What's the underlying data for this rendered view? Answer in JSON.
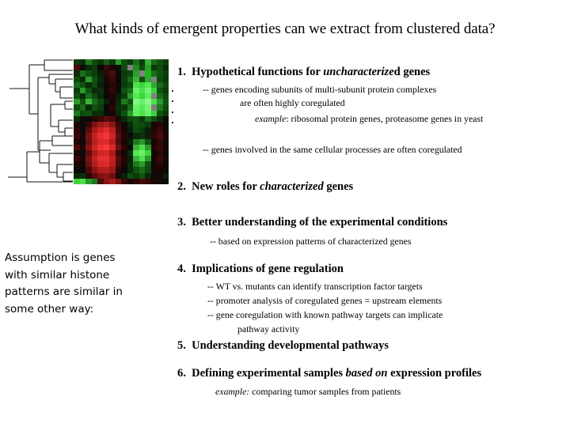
{
  "slide": {
    "title": "What kinds of emergent properties can we extract from clustered data?",
    "background_color": "#ffffff",
    "text_color": "#000000"
  },
  "figure": {
    "name": "hierarchical-clustering-heatmap",
    "colors": {
      "high_expression": "#00ff00",
      "low_expression": "#ff0000",
      "no_change": "#000000",
      "missing_data": "#808080",
      "dendrogram_line": "#000000"
    },
    "rows": 22,
    "columns": 16,
    "row_ellipsis_dots": 4,
    "heatmap_cells": [
      [
        "#0b3d0b",
        "#0a2f0a",
        "#1f7a1f",
        "#0d4a0d",
        "#083708",
        "#156015",
        "#0a3a0a",
        "#2a9a2a",
        "#0e4f0e",
        "#0a3a0a",
        "#1c6f1c",
        "#0a3a0a",
        "#37b337",
        "#1a6b1a",
        "#0f520f",
        "#0a3a0a"
      ],
      [
        "#4a0808",
        "#120c08",
        "#0a2a0a",
        "#0d3a0d",
        "#080808",
        "#3c0606",
        "#1a0505",
        "#0a0a0a",
        "#0f4a0f",
        "#808080",
        "#22881f",
        "#0d4a0d",
        "#2e9e2e",
        "#0a3a0a",
        "#0d4a0d",
        "#0a2a0a"
      ],
      [
        "#0a2a0a",
        "#1a6b1a",
        "#0f520f",
        "#0b3d0b",
        "#081f08",
        "#2a0808",
        "#4a0a0a",
        "#0a0a0a",
        "#0a3a0a",
        "#0d4a0d",
        "#2e9e2e",
        "#808080",
        "#15bd15",
        "#1a6b1a",
        "#0f520f",
        "#0b3d0b"
      ],
      [
        "#0d4a0d",
        "#0a2a0a",
        "#2a9a2a",
        "#0f520f",
        "#0a2a0a",
        "#180505",
        "#3a0707",
        "#080808",
        "#0b3d0b",
        "#1a6b1a",
        "#3cb33c",
        "#0f520f",
        "#2fa82f",
        "#808080",
        "#0d4a0d",
        "#0a3a0a"
      ],
      [
        "#1a6b1a",
        "#0f520f",
        "#0a2a0a",
        "#0d4a0d",
        "#081f08",
        "#0a0a0a",
        "#2a0606",
        "#120808",
        "#0a3a0a",
        "#0d4a0d",
        "#4ede4e",
        "#3cd43c",
        "#55ea55",
        "#2fa82f",
        "#1a6b1a",
        "#0d4a0d"
      ],
      [
        "#0b3d0b",
        "#2a9a2a",
        "#0f520f",
        "#0a2a0a",
        "#0d2f0d",
        "#180505",
        "#350606",
        "#0a0a0a",
        "#0f520f",
        "#1a6b1a",
        "#6bf06b",
        "#4ede4e",
        "#72f572",
        "#3cd43c",
        "#0f520f",
        "#0a3a0a"
      ],
      [
        "#0f520f",
        "#0a2a0a",
        "#1a6b1a",
        "#0d4a0d",
        "#0a2a0a",
        "#0a0a0a",
        "#220505",
        "#081f08",
        "#0b3d0b",
        "#2a9a2a",
        "#55ea55",
        "#3cd43c",
        "#5fee5f",
        "#808080",
        "#1a6b1a",
        "#0d4a0d"
      ],
      [
        "#2a9a2a",
        "#0f520f",
        "#3cb33c",
        "#1a6b1a",
        "#0d4a0d",
        "#0a1f0a",
        "#1a0505",
        "#0a2a0a",
        "#1f7a1f",
        "#0f520f",
        "#7ff87f",
        "#6bf06b",
        "#8afa8a",
        "#4ede4e",
        "#2a9a2a",
        "#0f520f"
      ],
      [
        "#0d4a0d",
        "#1a6b1a",
        "#0a2a0a",
        "#0f520f",
        "#0b3d0b",
        "#080808",
        "#2a0606",
        "#0d2f0d",
        "#0a3a0a",
        "#1a6b1a",
        "#6bf06b",
        "#55ea55",
        "#72f572",
        "#808080",
        "#1f7a1f",
        "#0d4a0d"
      ],
      [
        "#1f7a1f",
        "#0d4a0d",
        "#0f520f",
        "#0a2a0a",
        "#0a2a0a",
        "#0d0a0a",
        "#1a0505",
        "#0a2a0a",
        "#0f520f",
        "#2a9a2a",
        "#5fee5f",
        "#4ede4e",
        "#66ef66",
        "#3cd43c",
        "#0f520f",
        "#0a3a0a"
      ],
      [
        "#0a2a0a",
        "#120808",
        "#0a0a0a",
        "#2a0606",
        "#3a0707",
        "#5a0c0c",
        "#4a0a0a",
        "#1a0505",
        "#0a2a0a",
        "#0d4a0d",
        "#0f520f",
        "#0a3a0a",
        "#1a6b1a",
        "#0d4a0d",
        "#0a2a0a",
        "#120808"
      ],
      [
        "#1a0505",
        "#0a0a0a",
        "#350606",
        "#7a1212",
        "#9a1a1a",
        "#b01f1f",
        "#8a1515",
        "#3a0707",
        "#0d0a0a",
        "#0a2a0a",
        "#0f520f",
        "#0d4a0d",
        "#0a3a0a",
        "#180505",
        "#2a0606",
        "#0a0a0a"
      ],
      [
        "#2a0606",
        "#0d0a0a",
        "#5a0c0c",
        "#a81c1c",
        "#cf2424",
        "#e02b2b",
        "#b82020",
        "#4a0a0a",
        "#180505",
        "#0a1f0a",
        "#0d4a0d",
        "#0a3a0a",
        "#081f08",
        "#220505",
        "#3a0707",
        "#120808"
      ],
      [
        "#3a0707",
        "#180505",
        "#7a1212",
        "#c02222",
        "#e83030",
        "#f23636",
        "#cf2424",
        "#5a0c0c",
        "#220505",
        "#0a0a0a",
        "#0a2a0a",
        "#0d2f0d",
        "#0a1f0a",
        "#2a0606",
        "#4a0a0a",
        "#1a0505"
      ],
      [
        "#220505",
        "#0d0a0a",
        "#6a1010",
        "#b82020",
        "#d82828",
        "#e02b2b",
        "#b01f1f",
        "#4a0a0a",
        "#1a0505",
        "#0a1f0a",
        "#1f7a1f",
        "#2a9a2a",
        "#0f520f",
        "#180505",
        "#350606",
        "#0a0a0a"
      ],
      [
        "#4a0a0a",
        "#220505",
        "#8a1515",
        "#cf2424",
        "#ef3434",
        "#f53a3a",
        "#d82828",
        "#6a1010",
        "#2a0606",
        "#0a0a0a",
        "#3cb33c",
        "#4ede4e",
        "#2a9a2a",
        "#220505",
        "#3a0707",
        "#180505"
      ],
      [
        "#180505",
        "#0a0a0a",
        "#5a0c0c",
        "#a81c1c",
        "#cf2424",
        "#d82828",
        "#a81c1c",
        "#3a0707",
        "#120808",
        "#0d2f0d",
        "#55ea55",
        "#6bf06b",
        "#3cd43c",
        "#0d0a0a",
        "#2a0606",
        "#0a0a0a"
      ],
      [
        "#350606",
        "#1a0505",
        "#7a1212",
        "#c02222",
        "#e03030",
        "#e83030",
        "#c02222",
        "#5a0c0c",
        "#220505",
        "#0a1f0a",
        "#3cb33c",
        "#4ede4e",
        "#2a9a2a",
        "#180505",
        "#3a0707",
        "#120808"
      ],
      [
        "#220505",
        "#120808",
        "#6a1010",
        "#b01f1f",
        "#d82828",
        "#e02b2b",
        "#b82020",
        "#4a0a0a",
        "#1a0505",
        "#0a2a0a",
        "#1f7a1f",
        "#2a9a2a",
        "#0f520f",
        "#0d0a0a",
        "#2a0606",
        "#0a0a0a"
      ],
      [
        "#0d0a0a",
        "#0a0a0a",
        "#4a0a0a",
        "#8a1515",
        "#b01f1f",
        "#b82020",
        "#9a1a1a",
        "#2a0606",
        "#0a0a0a",
        "#0a2a0a",
        "#0f520f",
        "#1a6b1a",
        "#0d4a0d",
        "#180505",
        "#1a0505",
        "#0a0a0a"
      ],
      [
        "#0a2a0a",
        "#0d2f0d",
        "#2a0606",
        "#5a0c0c",
        "#7a1212",
        "#8a1515",
        "#6a1010",
        "#180505",
        "#0a1f0a",
        "#0d4a0d",
        "#0a3a0a",
        "#0f520f",
        "#0a2a0a",
        "#0d0a0a",
        "#120808",
        "#0a1f0a"
      ],
      [
        "#3cd43c",
        "#4ede4e",
        "#2a9a2a",
        "#1f7a1f",
        "#4a0a0a",
        "#8a1515",
        "#a81c1c",
        "#7a1212",
        "#3a0707",
        "#1a0505",
        "#2a0606",
        "#4a0a0a",
        "#350606",
        "#1a0505",
        "#120808",
        "#0a0a0a"
      ]
    ]
  },
  "assumption_note": {
    "name": "assumption-note",
    "lines": [
      "Assumption is genes",
      "with similar histone",
      "patterns are similar in",
      "some other way:"
    ]
  },
  "items": [
    {
      "number": "1.",
      "heading_pre": "Hypothetical functions for ",
      "heading_italic": "uncharacterize",
      "heading_post": "d genes",
      "subs": [
        "-- genes encoding subunits of multi-subunit protein complexes",
        "are often highly coregulated"
      ],
      "example_italic": "example",
      "example_rest": ":  ribosomal protein genes, proteasome genes in yeast"
    },
    {
      "number": "2.",
      "heading_pre": "New  roles for ",
      "heading_italic": "characterized",
      "heading_post": " genes",
      "subs": [],
      "example_italic": "",
      "example_rest": ""
    },
    {
      "number": "3.",
      "heading_pre": "Better understanding of the experimental conditions",
      "heading_italic": "",
      "heading_post": "",
      "subs": [
        "-- based on expression patterns of characterized genes"
      ],
      "example_italic": "",
      "example_rest": ""
    },
    {
      "number": "4.",
      "heading_pre": "Implications of gene regulation",
      "heading_italic": "",
      "heading_post": "",
      "subs": [
        "-- WT vs. mutants can identify transcription factor targets",
        "-- promoter analysis of coregulated genes = upstream elements",
        "-- gene coregulation with known pathway targets can implicate",
        "pathway activity"
      ],
      "example_italic": "",
      "example_rest": ""
    },
    {
      "number": "5.",
      "heading_pre": "Understanding developmental pathways",
      "heading_italic": "",
      "heading_post": "",
      "subs": [],
      "example_italic": "",
      "example_rest": ""
    },
    {
      "number": "6.",
      "heading_pre": "Defining experimental samples ",
      "heading_italic": "based on",
      "heading_post": " expression profiles",
      "subs": [],
      "example_italic": "example:",
      "example_rest": " comparing tumor samples from patients"
    }
  ],
  "standalone_sub": "-- genes involved in the same cellular processes are often coregulated"
}
